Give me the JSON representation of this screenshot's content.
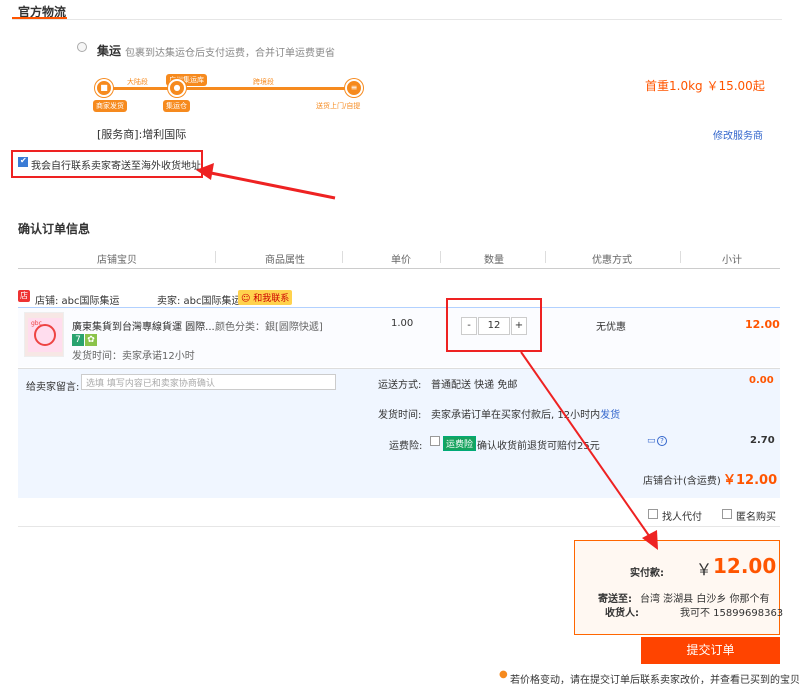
{
  "logistics": {
    "section_title": "官方物流",
    "method_label": "集运",
    "method_desc": "包裹到达集运仓后支付运费，合并订单运费更省",
    "route": {
      "seg1": "大陆段",
      "badge": "广州集运库",
      "seg2": "跨境段",
      "start": "商家发货",
      "mid": "集运仓",
      "end": "送货上门/自提"
    },
    "first_weight_price": "首重1.0kg ￥15.00起",
    "provider": "[服务商]:增利国际",
    "modify_link": "修改服务商",
    "self_contact_label": "我会自行联系卖家寄送至海外收货地址"
  },
  "order": {
    "title": "确认订单信息",
    "columns": [
      "店铺宝贝",
      "商品属性",
      "单价",
      "数量",
      "优惠方式",
      "小计"
    ],
    "shop_label": "店铺: abc国际集运",
    "seller_label": "卖家: abc国际集运",
    "contact_label": "和我联系",
    "item": {
      "title": "廣東集貨到台灣專線貨運 圆際...",
      "attr": "颜色分类：銀[圆際快遞]",
      "ship_time": "发货时间：卖家承诺12小时",
      "unit_price": "1.00",
      "qty_minus": "-",
      "qty": "12",
      "qty_plus": "+",
      "discount": "无优惠",
      "subtotal": "12.00"
    },
    "message_label": "给卖家留言:",
    "message_placeholder": "选填  填写内容已和卖家协商确认",
    "shipping_label": "运送方式:",
    "shipping_value": "普通配送 快递 免邮",
    "shipping_fee": "0.00",
    "ship_time_label": "发货时间:",
    "ship_time_value": "卖家承诺订单在买家付款后, 12小时内",
    "ship_time_link": "发货",
    "insurance_label": "运费险:",
    "insurance_badge": "运费险",
    "insurance_desc": "确认收货前退货可赔付25元",
    "insurance_fee": "2.70",
    "store_total_label": "店铺合计(含运费)",
    "store_total_value": "￥12.00",
    "proxy_pay": "找人代付",
    "anonymous": "匿名购买"
  },
  "payment": {
    "label": "实付款:",
    "yen": "￥",
    "amount": "12.00",
    "addr_label": "寄送至:",
    "addr_value": "台湾 澎湖县 白沙乡   你那个有",
    "recv_label": "收货人:",
    "recv_value": "我可不  15899698363",
    "submit": "提交订单",
    "footer_note": "若价格变动，请在提交订单后联系卖家改价，并查看已买到的宝贝"
  },
  "colors": {
    "accent": "#ff5500",
    "annotation_red": "#e22222",
    "route_orange": "#f68a1e"
  }
}
